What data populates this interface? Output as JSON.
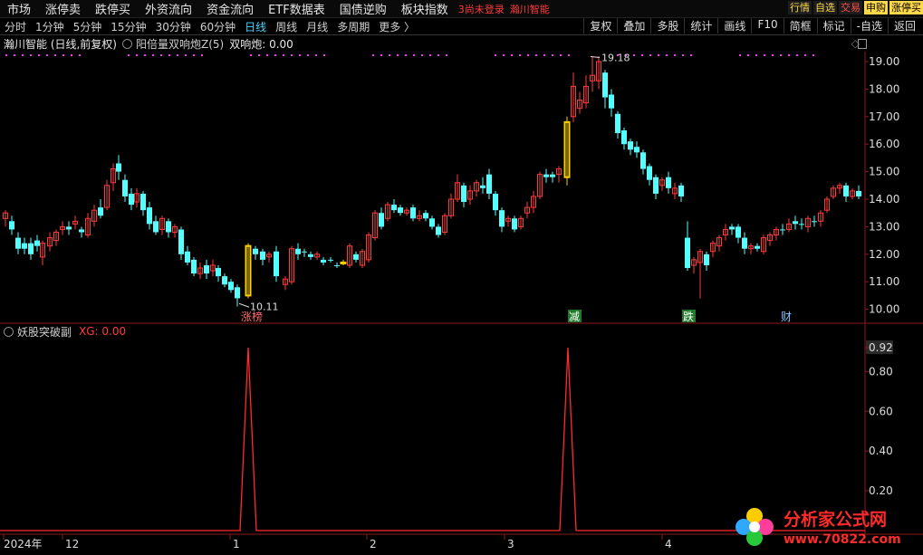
{
  "menu": {
    "items": [
      "市场",
      "涨停卖",
      "跌停买",
      "外资流向",
      "资金流向",
      "ETF数据表",
      "国债逆购",
      "板块指数"
    ],
    "warn1": "3尚未登录",
    "warn2": "瀚川智能",
    "right_tags": [
      {
        "label": "行情",
        "color": "#ffd94a",
        "bg": "#1c1c1c"
      },
      {
        "label": "自选",
        "color": "#ffd94a",
        "bg": "#1c1c1c"
      },
      {
        "label": "交易",
        "color": "#ff4d4d",
        "bg": "#1c1c1c"
      },
      {
        "label": "申购",
        "color": "#000",
        "bg": "#ffd94a"
      },
      {
        "label": "涨停买",
        "color": "#000",
        "bg": "#ffd94a"
      }
    ]
  },
  "periods": {
    "items": [
      "分时",
      "1分钟",
      "5分钟",
      "15分钟",
      "30分钟",
      "60分钟",
      "日线",
      "周线",
      "月线",
      "多周期",
      "更多 〉"
    ],
    "active": "日线",
    "tools": [
      "复权",
      "叠加",
      "多股",
      "统计",
      "画线",
      "F10",
      "简框",
      "标记",
      "-自选",
      "返回"
    ]
  },
  "main_panel": {
    "title": "瀚川智能 (日线,前复权)",
    "indicator": "阳倍量双响炮Z(5)",
    "indicator_value": "双响炮: 0.00",
    "y_ticks": [
      "19.00",
      "18.00",
      "17.00",
      "16.00",
      "15.00",
      "14.00",
      "13.00",
      "12.00",
      "11.00",
      "10.00"
    ],
    "high_label": "19.18",
    "low_label": "10.11",
    "markers": [
      {
        "text": "涨榜",
        "color": "#ff6b6b"
      },
      {
        "text": "减",
        "color": "#ffffff",
        "bg": "#1f7a2b"
      },
      {
        "text": "跌",
        "color": "#ffffff",
        "bg": "#1f7a2b"
      },
      {
        "text": "财",
        "color": "#7fc6ff"
      }
    ]
  },
  "sub_panel": {
    "title": "妖股突破副",
    "series_label": "XG: 0.00",
    "y_ticks": [
      "0.92",
      "0.80",
      "0.60",
      "0.40",
      "0.20"
    ]
  },
  "x_axis": {
    "labels": [
      "2024年",
      "12",
      "1",
      "2",
      "3",
      "4"
    ]
  },
  "watermark": {
    "line1": "分析家公式网",
    "line2": "www.70822.com"
  },
  "colors": {
    "up": "#ff3b3b",
    "down": "#54ffff",
    "highlight": "#ffd000",
    "line": "#ff2a2a",
    "dot": "#ff33ff"
  }
}
